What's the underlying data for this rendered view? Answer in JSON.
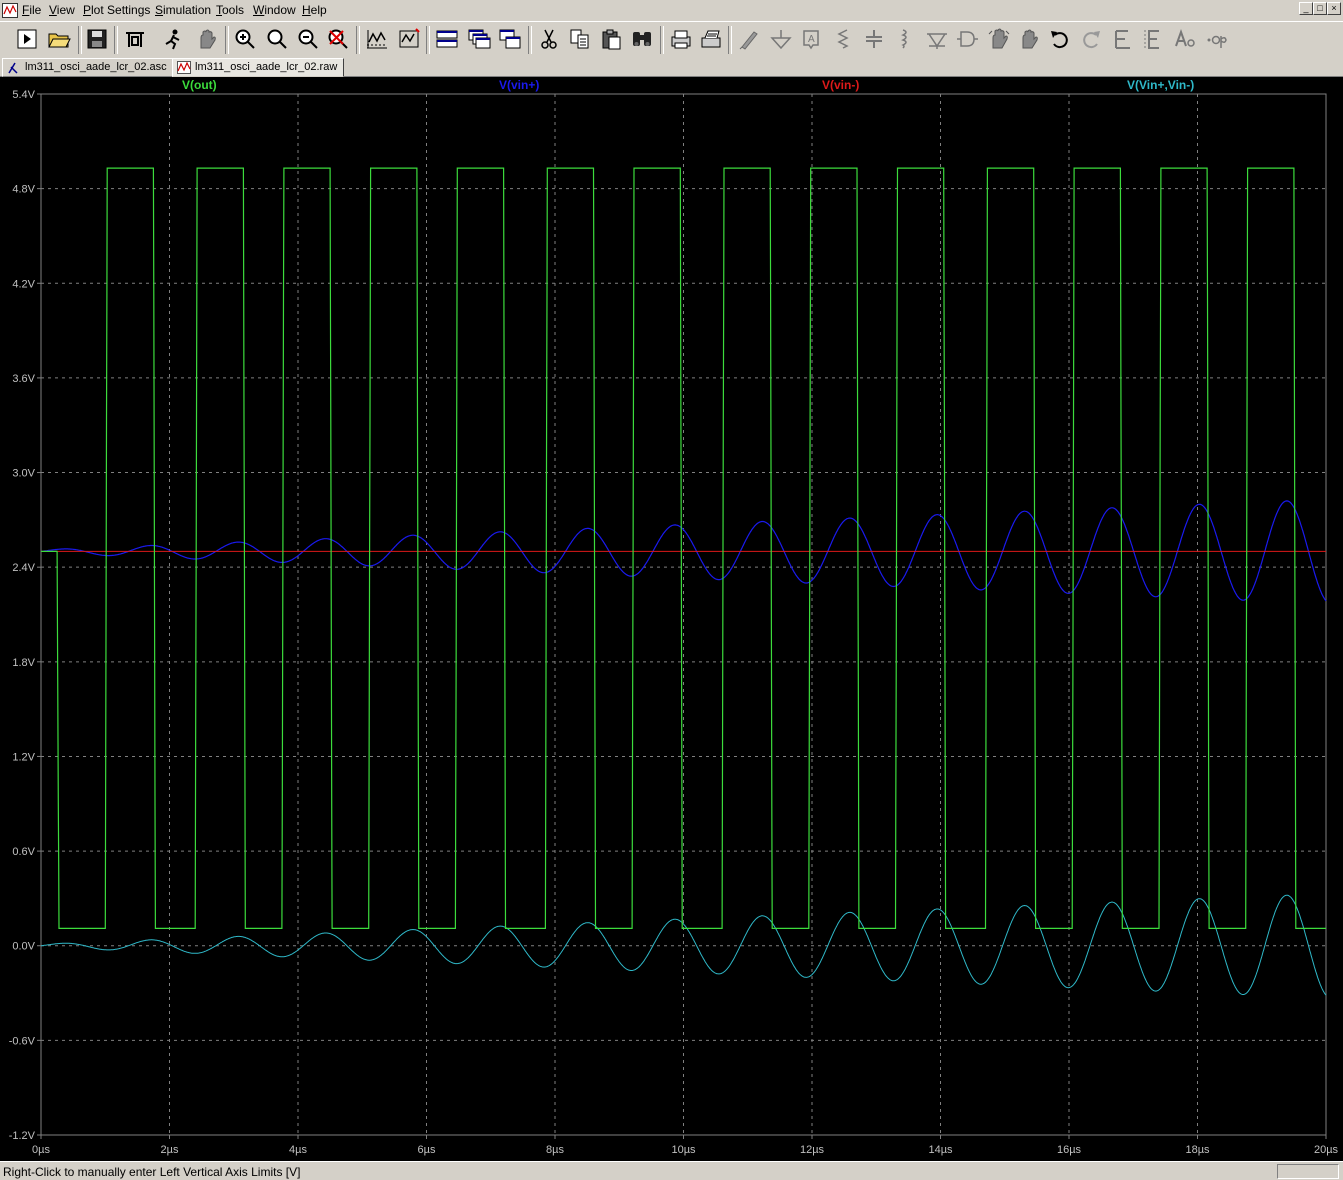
{
  "menu": [
    "File",
    "View",
    "Plot Settings",
    "Simulation",
    "Tools",
    "Window",
    "Help"
  ],
  "menu_access_keys": [
    "F",
    "V",
    "P",
    "S",
    "T",
    "W",
    "H"
  ],
  "window_buttons": [
    "_",
    "□",
    "×"
  ],
  "toolbar": [
    "run-icon",
    "open-icon",
    "save-icon",
    "control-panel-icon",
    "run-simulation-icon",
    "halt-icon",
    "zoom-in-icon",
    "zoom-fit-icon",
    "zoom-out-icon",
    "zoom-cancel-icon",
    "autorange-icon",
    "plot-pane-icon",
    "tile-horizontal-icon",
    "cascade-icon",
    "tile-vertical-icon",
    "cut-icon",
    "copy-icon",
    "paste-icon",
    "find-icon",
    "print-icon",
    "print-setup-icon",
    "wire-icon",
    "ground-icon",
    "label-icon",
    "resistor-icon",
    "capacitor-icon",
    "inductor-icon",
    "diode-icon",
    "component-icon",
    "move-icon",
    "drag-icon",
    "undo-icon",
    "redo-icon",
    "rotate-icon",
    "mirror-icon",
    "text-icon",
    "spice-directive-icon"
  ],
  "tabs": [
    {
      "label": "lm311_osci_aade_lcr_02.asc",
      "icon": "schematic-icon",
      "active": false
    },
    {
      "label": "lm311_osci_aade_lcr_02.raw",
      "icon": "waveform-icon",
      "active": true
    }
  ],
  "plot": {
    "background": "#000000",
    "grid_color": "#808080",
    "traces": [
      {
        "name": "V(out)",
        "color": "#3cdc3c"
      },
      {
        "name": "V(vin+)",
        "color": "#1a1aee"
      },
      {
        "name": "V(vin-)",
        "color": "#dd1a1a"
      },
      {
        "name": "V(Vin+,Vin-)",
        "color": "#2fb9c9"
      }
    ],
    "y_ticks": [
      "5.4V",
      "4.8V",
      "4.2V",
      "3.6V",
      "3.0V",
      "2.4V",
      "1.8V",
      "1.2V",
      "0.6V",
      "0.0V",
      "-0.6V",
      "-1.2V"
    ],
    "x_ticks": [
      "0µs",
      "2µs",
      "4µs",
      "6µs",
      "8µs",
      "10µs",
      "12µs",
      "14µs",
      "16µs",
      "18µs",
      "20µs"
    ]
  },
  "chart_data": {
    "type": "line",
    "x_unit": "µs",
    "y_unit": "V",
    "xlim": [
      0,
      20
    ],
    "ylim": [
      -1.2,
      5.4
    ],
    "grid": true,
    "series": [
      {
        "name": "V(out)",
        "high": 4.93,
        "low": 0.11,
        "initial": 2.5,
        "edges_us": [
          0.25,
          1.0,
          1.75,
          2.4,
          3.15,
          3.75,
          4.5,
          5.1,
          5.85,
          6.45,
          7.2,
          7.85,
          8.6,
          9.2,
          9.95,
          10.6,
          11.35,
          11.95,
          12.7,
          13.3,
          14.05,
          14.7,
          15.45,
          16.05,
          16.8,
          17.4,
          18.15,
          18.75,
          19.5
        ]
      },
      {
        "name": "V(vin+)",
        "offset": 2.5,
        "frequency_mhz": 0.735,
        "amplitude_start": 0.01,
        "amplitude_end": 0.33
      },
      {
        "name": "V(vin-)",
        "constant": 2.5
      },
      {
        "name": "V(Vin+,Vin-)",
        "offset": 0.0,
        "frequency_mhz": 0.735,
        "amplitude_start": 0.01,
        "amplitude_end": 0.33
      }
    ]
  },
  "status": {
    "text": "Right-Click to manually enter Left Vertical Axis Limits [V]"
  }
}
